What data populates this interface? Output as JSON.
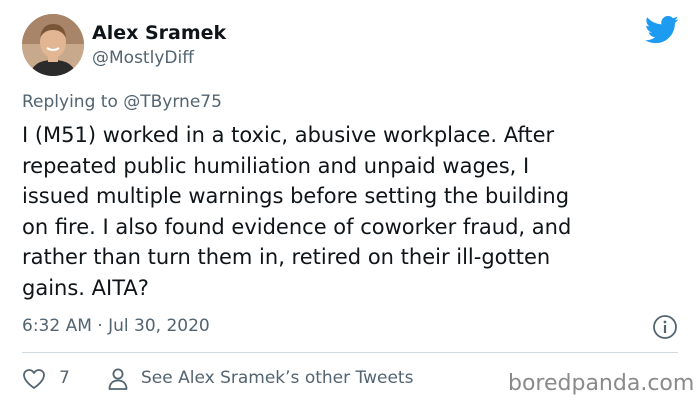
{
  "author": {
    "display_name": "Alex Sramek",
    "handle": "@MostlyDiff"
  },
  "reply": {
    "prefix": "Replying to ",
    "mention": "@TByrne75"
  },
  "tweet": {
    "lines": [
      "I (M51) worked in a toxic, abusive workplace. After",
      "repeated public humiliation and unpaid wages, I",
      "issued multiple warnings before setting the building",
      "on fire. I also found evidence of coworker fraud, and",
      "rather than turn them in, retired on their ill-gotten",
      "gains. AITA?"
    ]
  },
  "timestamp": "6:32 AM · Jul 30, 2020",
  "actions": {
    "like_count": "7",
    "see_more_label": "See Alex Sramek’s other Tweets"
  },
  "watermark": "boredpanda.com",
  "icons": {
    "brand": "twitter-bird-icon",
    "info": "info-icon",
    "like": "heart-icon",
    "profile": "person-icon"
  },
  "colors": {
    "brand_blue": "#1d9bf0",
    "text": "#0f1419",
    "muted": "#536471",
    "divider": "#cfd9de"
  }
}
